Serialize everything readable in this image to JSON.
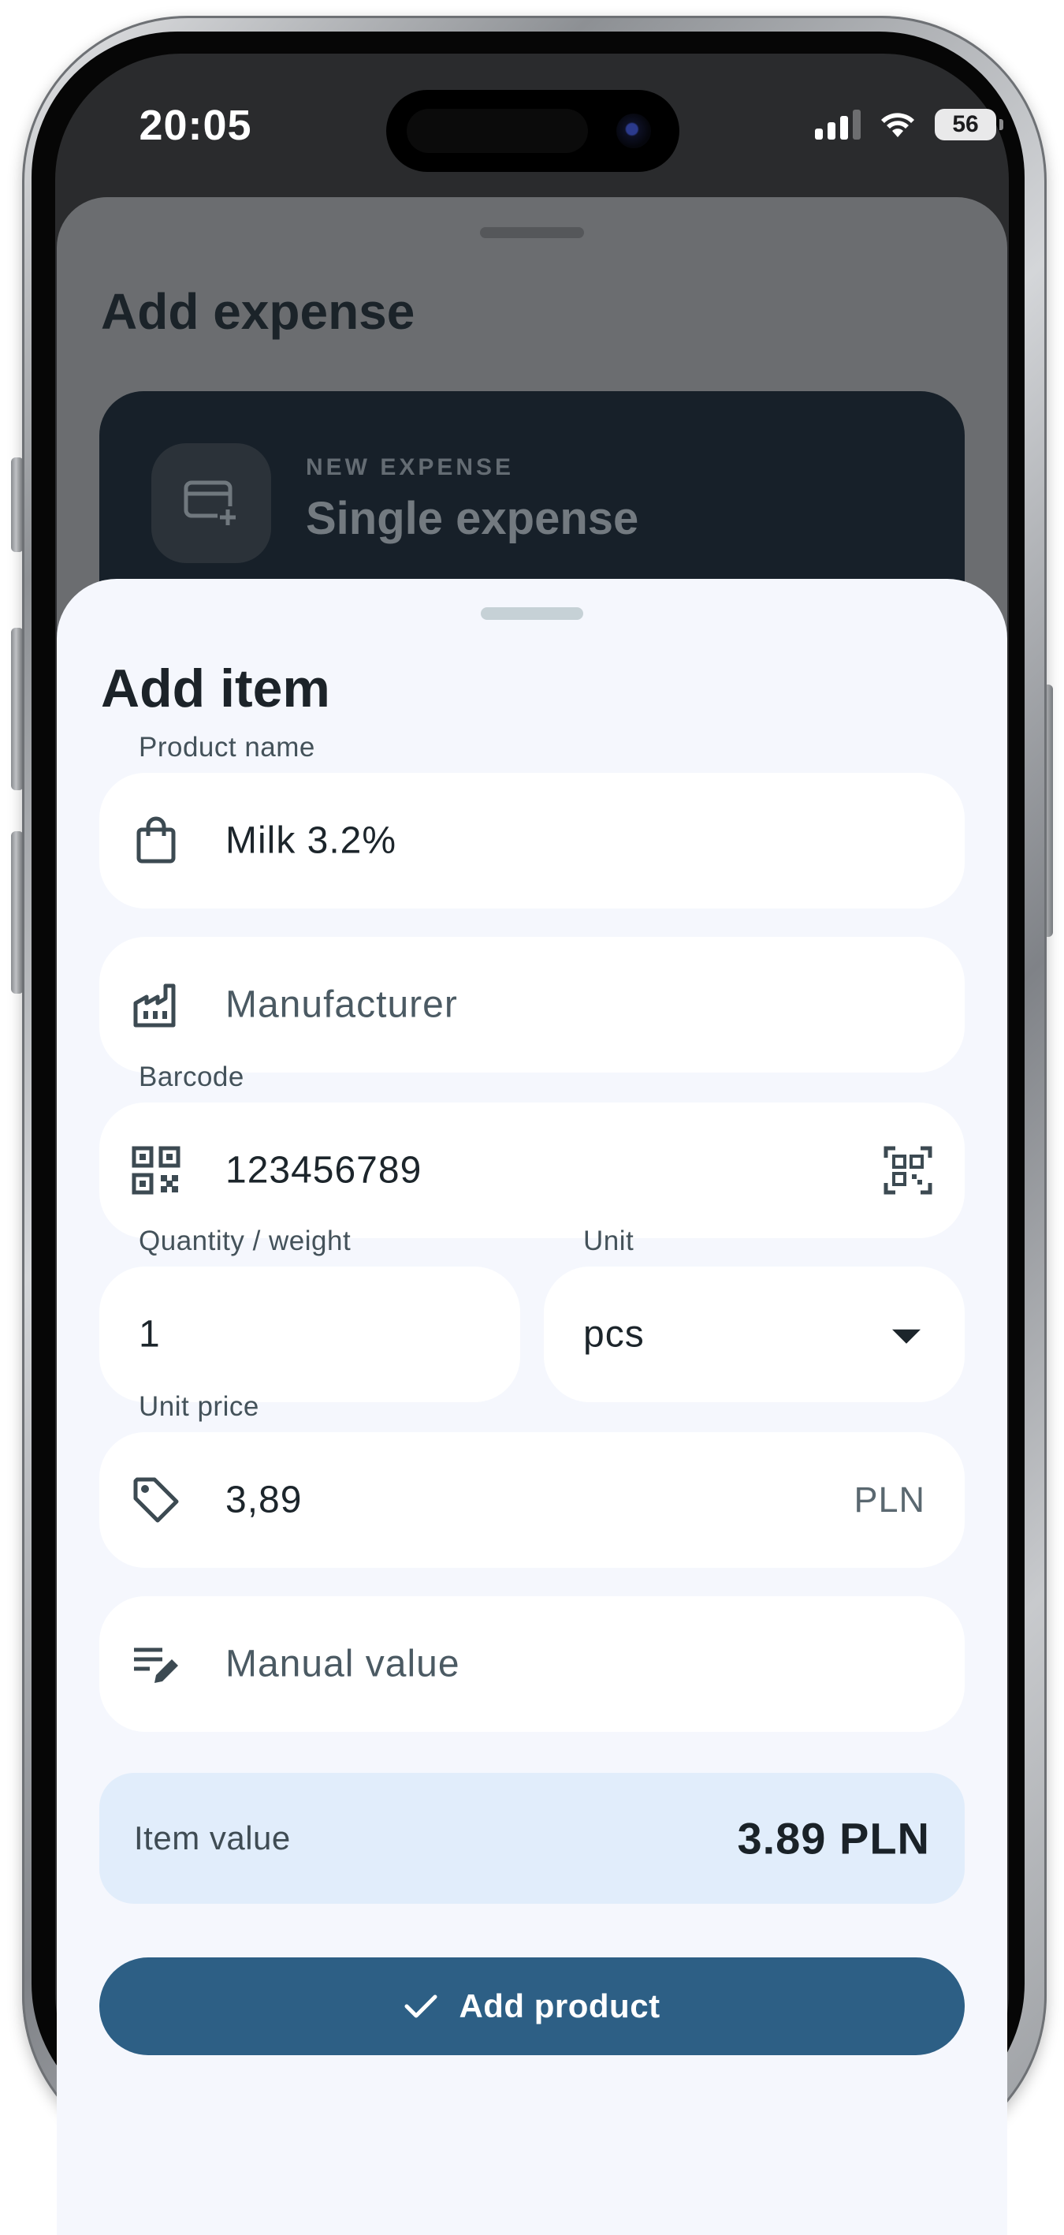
{
  "status_bar": {
    "time": "20:05",
    "battery": "56",
    "icons": [
      "cellular-signal-icon",
      "wifi-icon",
      "battery-icon"
    ]
  },
  "background_sheet": {
    "title": "Add expense",
    "card": {
      "overline": "NEW EXPENSE",
      "title": "Single expense",
      "icon": "card-add-icon"
    }
  },
  "sheet": {
    "title": "Add item",
    "product_name": {
      "label": "Product name",
      "value": "Milk 3.2%",
      "icon": "shopping-bag-icon"
    },
    "manufacturer": {
      "placeholder": "Manufacturer",
      "icon": "factory-icon"
    },
    "barcode": {
      "label": "Barcode",
      "value": "123456789",
      "icon": "qr-code-icon",
      "action_icon": "qr-scan-icon"
    },
    "quantity": {
      "label": "Quantity / weight",
      "value": "1"
    },
    "unit": {
      "label": "Unit",
      "value": "pcs",
      "icon": "dropdown-arrow-icon"
    },
    "unit_price": {
      "label": "Unit price",
      "value": "3,89",
      "currency": "PLN",
      "icon": "tag-icon"
    },
    "manual_value": {
      "placeholder": "Manual value",
      "icon": "edit-note-icon"
    },
    "item_value": {
      "label": "Item value",
      "value": "3.89 PLN"
    },
    "submit": {
      "label": "Add product",
      "icon": "check-icon"
    }
  },
  "colors": {
    "primary": "#2d5f85",
    "sheet_background": "#f5f7fd",
    "total_background": "#e1edfb",
    "overlay_card": "#172029"
  }
}
